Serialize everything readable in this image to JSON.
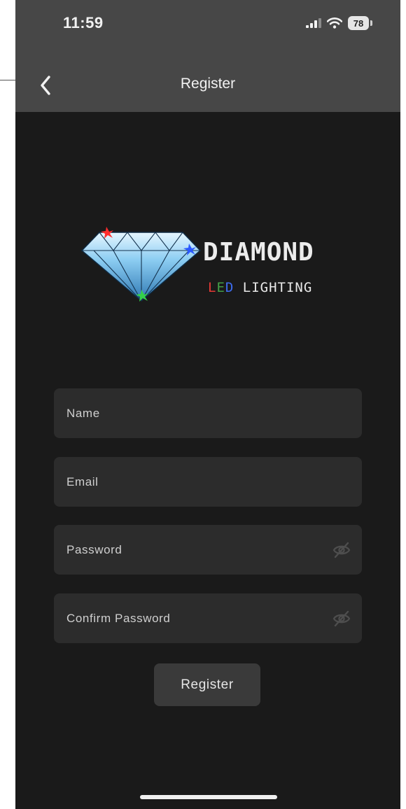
{
  "status_bar": {
    "time": "11:59",
    "battery_level": "78",
    "signal_icon": "cellular-signal-icon",
    "wifi_icon": "wifi-icon"
  },
  "nav": {
    "title": "Register",
    "back_icon": "chevron-left-icon"
  },
  "logo": {
    "brand_main": "DIAMOND",
    "brand_sub_l": "L",
    "brand_sub_e": "E",
    "brand_sub_d": "D",
    "brand_sub_rest": " LIGHTING"
  },
  "form": {
    "name_placeholder": "Name",
    "name_value": "",
    "email_placeholder": "Email",
    "email_value": "",
    "password_placeholder": "Password",
    "password_value": "",
    "confirm_placeholder": "Confirm Password",
    "confirm_value": "",
    "toggle_icon": "eye-off-icon",
    "submit_label": "Register"
  },
  "colors": {
    "top_bar": "#474747",
    "background": "#1a1a1a",
    "field": "#2c2c2c",
    "button": "#3a3a3a",
    "led_red": "#e53935",
    "led_green": "#43a047",
    "led_blue": "#3d6df2"
  }
}
